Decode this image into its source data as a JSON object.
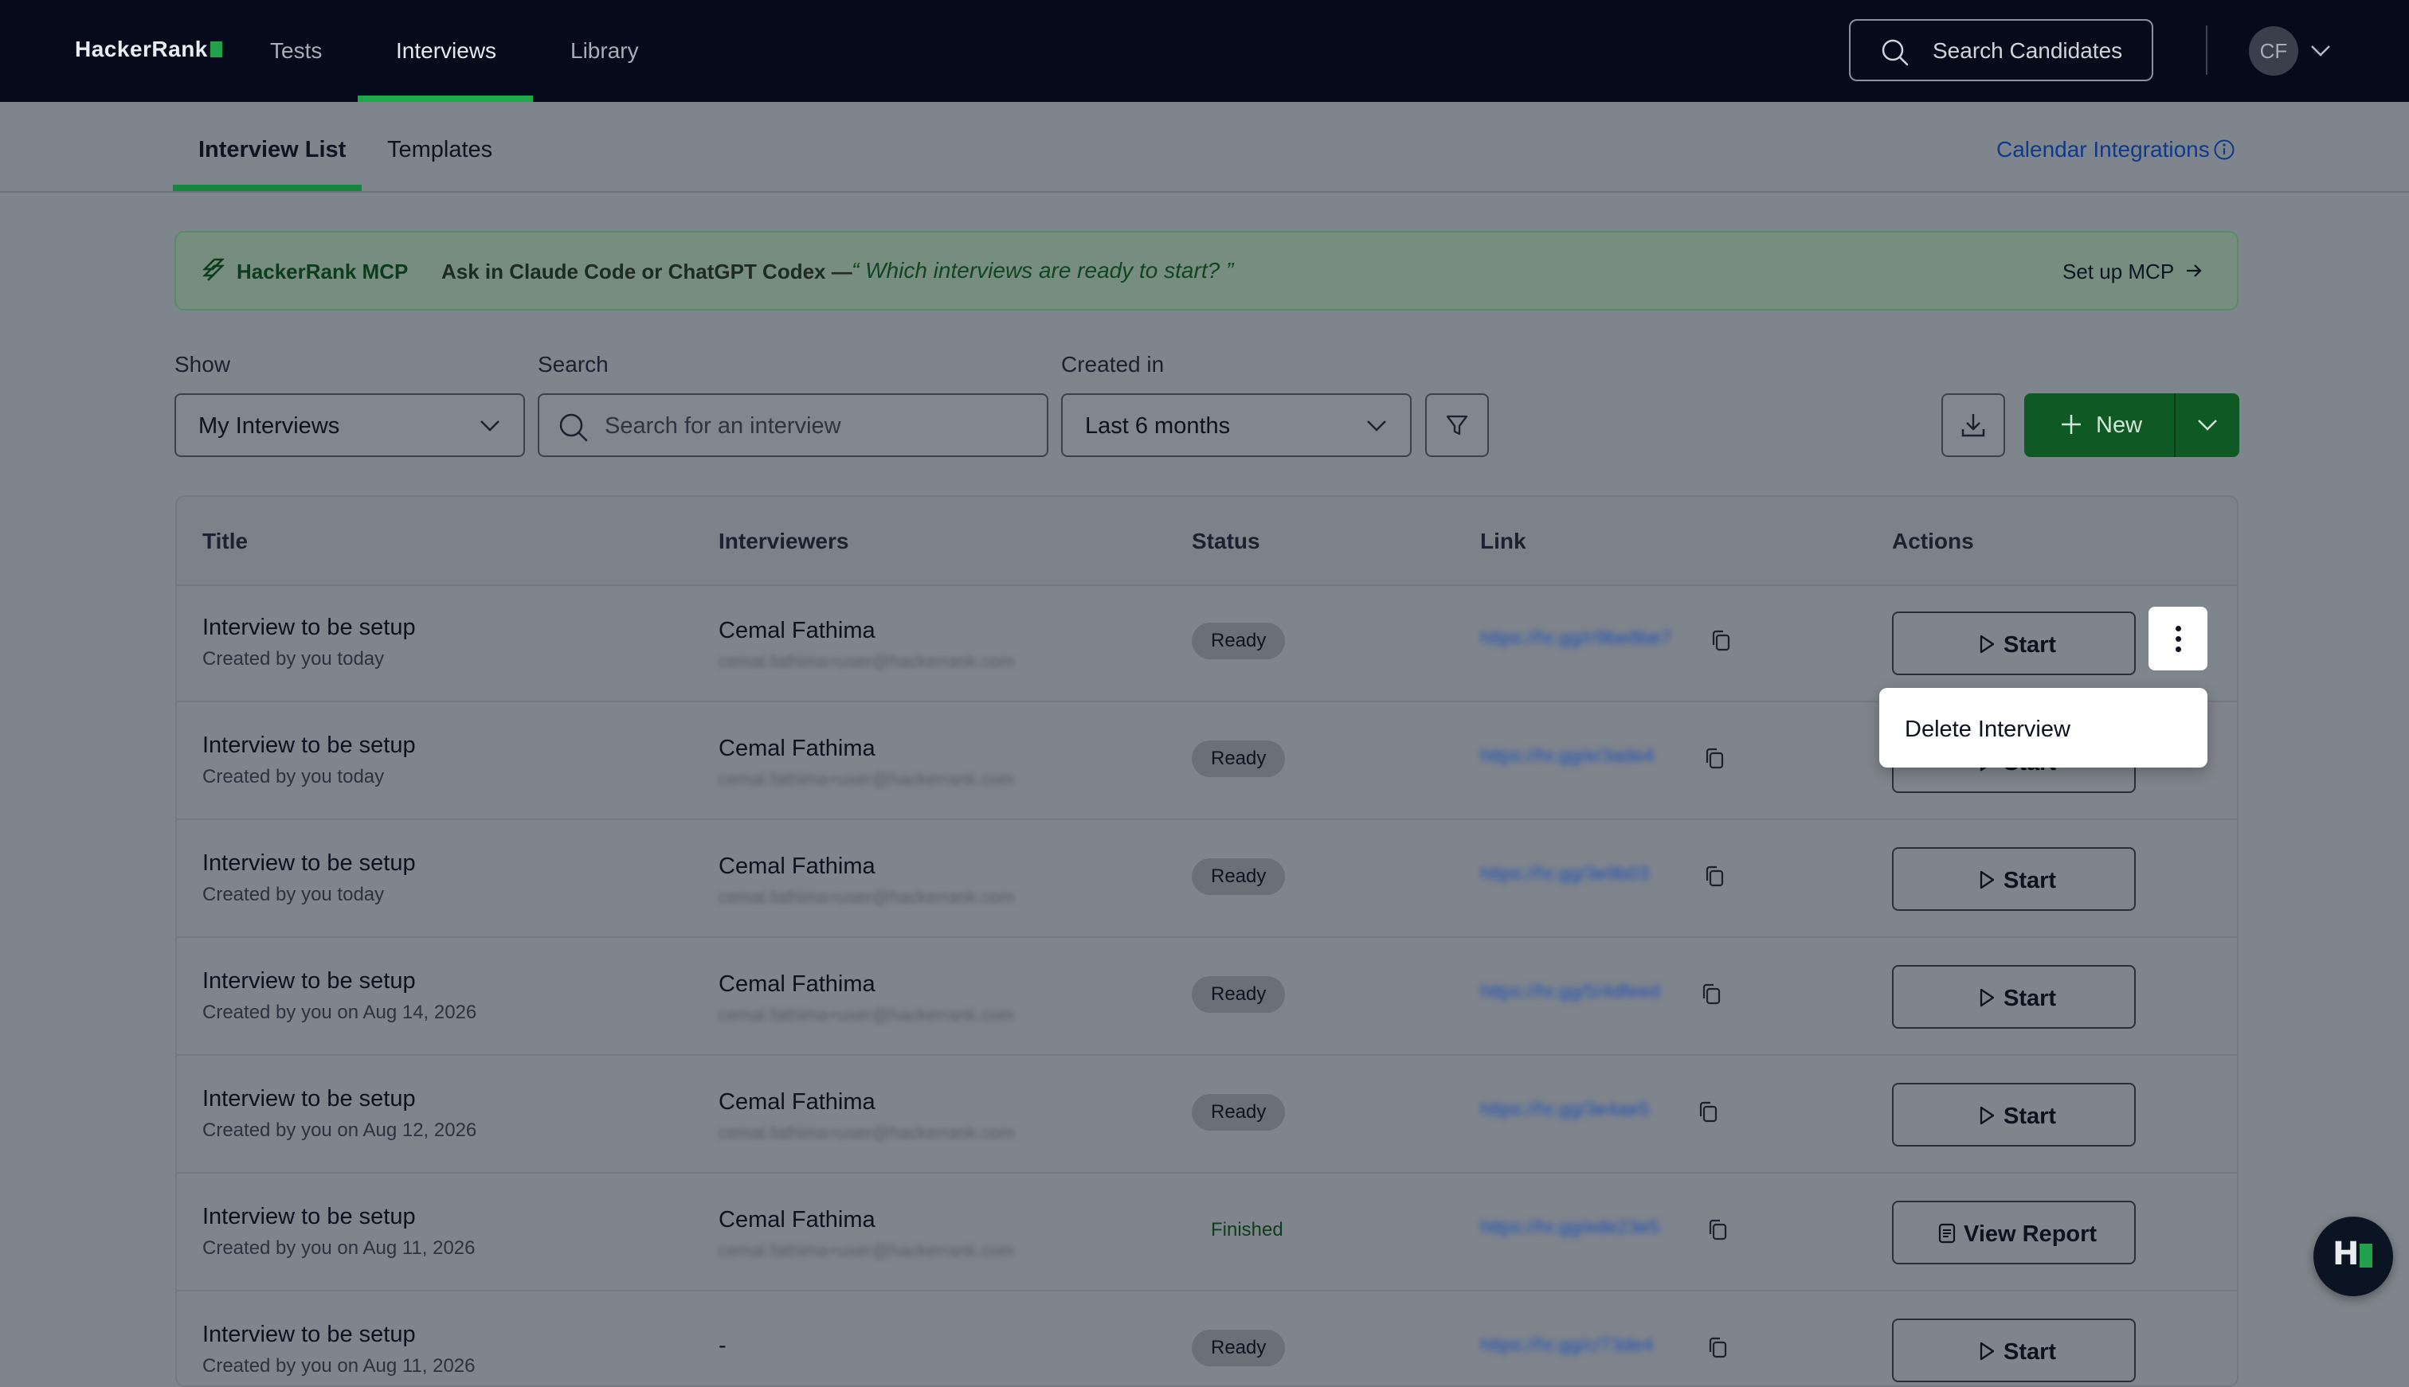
{
  "topnav": {
    "logo": "HackerRank",
    "items": [
      "Tests",
      "Interviews",
      "Library"
    ],
    "active": "Interviews",
    "search_label": "Search Candidates",
    "avatar_initials": "CF"
  },
  "subnav": {
    "tabs": [
      "Interview List",
      "Templates"
    ],
    "active": "Interview List",
    "calendar_integrations": "Calendar Integrations"
  },
  "banner": {
    "brand": "HackerRank MCP",
    "ask": "Ask in Claude Code or ChatGPT Codex —",
    "quote": "“ Which interviews are ready to start? ”",
    "setup": "Set up MCP"
  },
  "filters": {
    "show_label": "Show",
    "show_value": "My Interviews",
    "search_label": "Search",
    "search_placeholder": "Search for an interview",
    "created_label": "Created in",
    "created_value": "Last 6 months",
    "new_label": "New"
  },
  "table": {
    "headers": [
      "Title",
      "Interviewers",
      "Status",
      "Link",
      "Actions"
    ],
    "rows": [
      {
        "title": "Interview to be setup",
        "sub": "Created by you today",
        "interviewer": "Cemal Fathima",
        "email": "cemal.fathima+user@hackerrank.com",
        "status": "Ready",
        "link": "https://hr.gg/r/9be8be7",
        "action": "Start"
      },
      {
        "title": "Interview to be setup",
        "sub": "Created by you today",
        "interviewer": "Cemal Fathima",
        "email": "cemal.fathima+user@hackerrank.com",
        "status": "Ready",
        "link": "https://hr.gg/e/3ade4",
        "action": "Start"
      },
      {
        "title": "Interview to be setup",
        "sub": "Created by you today",
        "interviewer": "Cemal Fathima",
        "email": "cemal.fathima+user@hackerrank.com",
        "status": "Ready",
        "link": "https://hr.gg/3e9b03",
        "action": "Start"
      },
      {
        "title": "Interview to be setup",
        "sub": "Created by you on Aug 14, 2026",
        "interviewer": "Cemal Fathima",
        "email": "cemal.fathima+user@hackerrank.com",
        "status": "Ready",
        "link": "https://hr.gg/5/4dfeed",
        "action": "Start"
      },
      {
        "title": "Interview to be setup",
        "sub": "Created by you on Aug 12, 2026",
        "interviewer": "Cemal Fathima",
        "email": "cemal.fathima+user@hackerrank.com",
        "status": "Ready",
        "link": "https://hr.gg/3e4ae5",
        "action": "Start"
      },
      {
        "title": "Interview to be setup",
        "sub": "Created by you on Aug 11, 2026",
        "interviewer": "Cemal Fathima",
        "email": "cemal.fathima+user@hackerrank.com",
        "status": "Finished",
        "link": "https://hr.gg/ede23e5",
        "action": "View Report"
      },
      {
        "title": "Interview to be setup",
        "sub": "Created by you on Aug 11, 2026",
        "interviewer": "-",
        "email": "",
        "status": "Ready",
        "link": "https://hr.gg/c/73de4",
        "action": "Start"
      }
    ]
  },
  "menu": {
    "delete_label": "Delete Interview"
  },
  "colors": {
    "nav_bg": "#050b1a",
    "accent_green": "#1ba94c",
    "new_button": "#0f5a24",
    "overlay_page": "#7f858c"
  }
}
